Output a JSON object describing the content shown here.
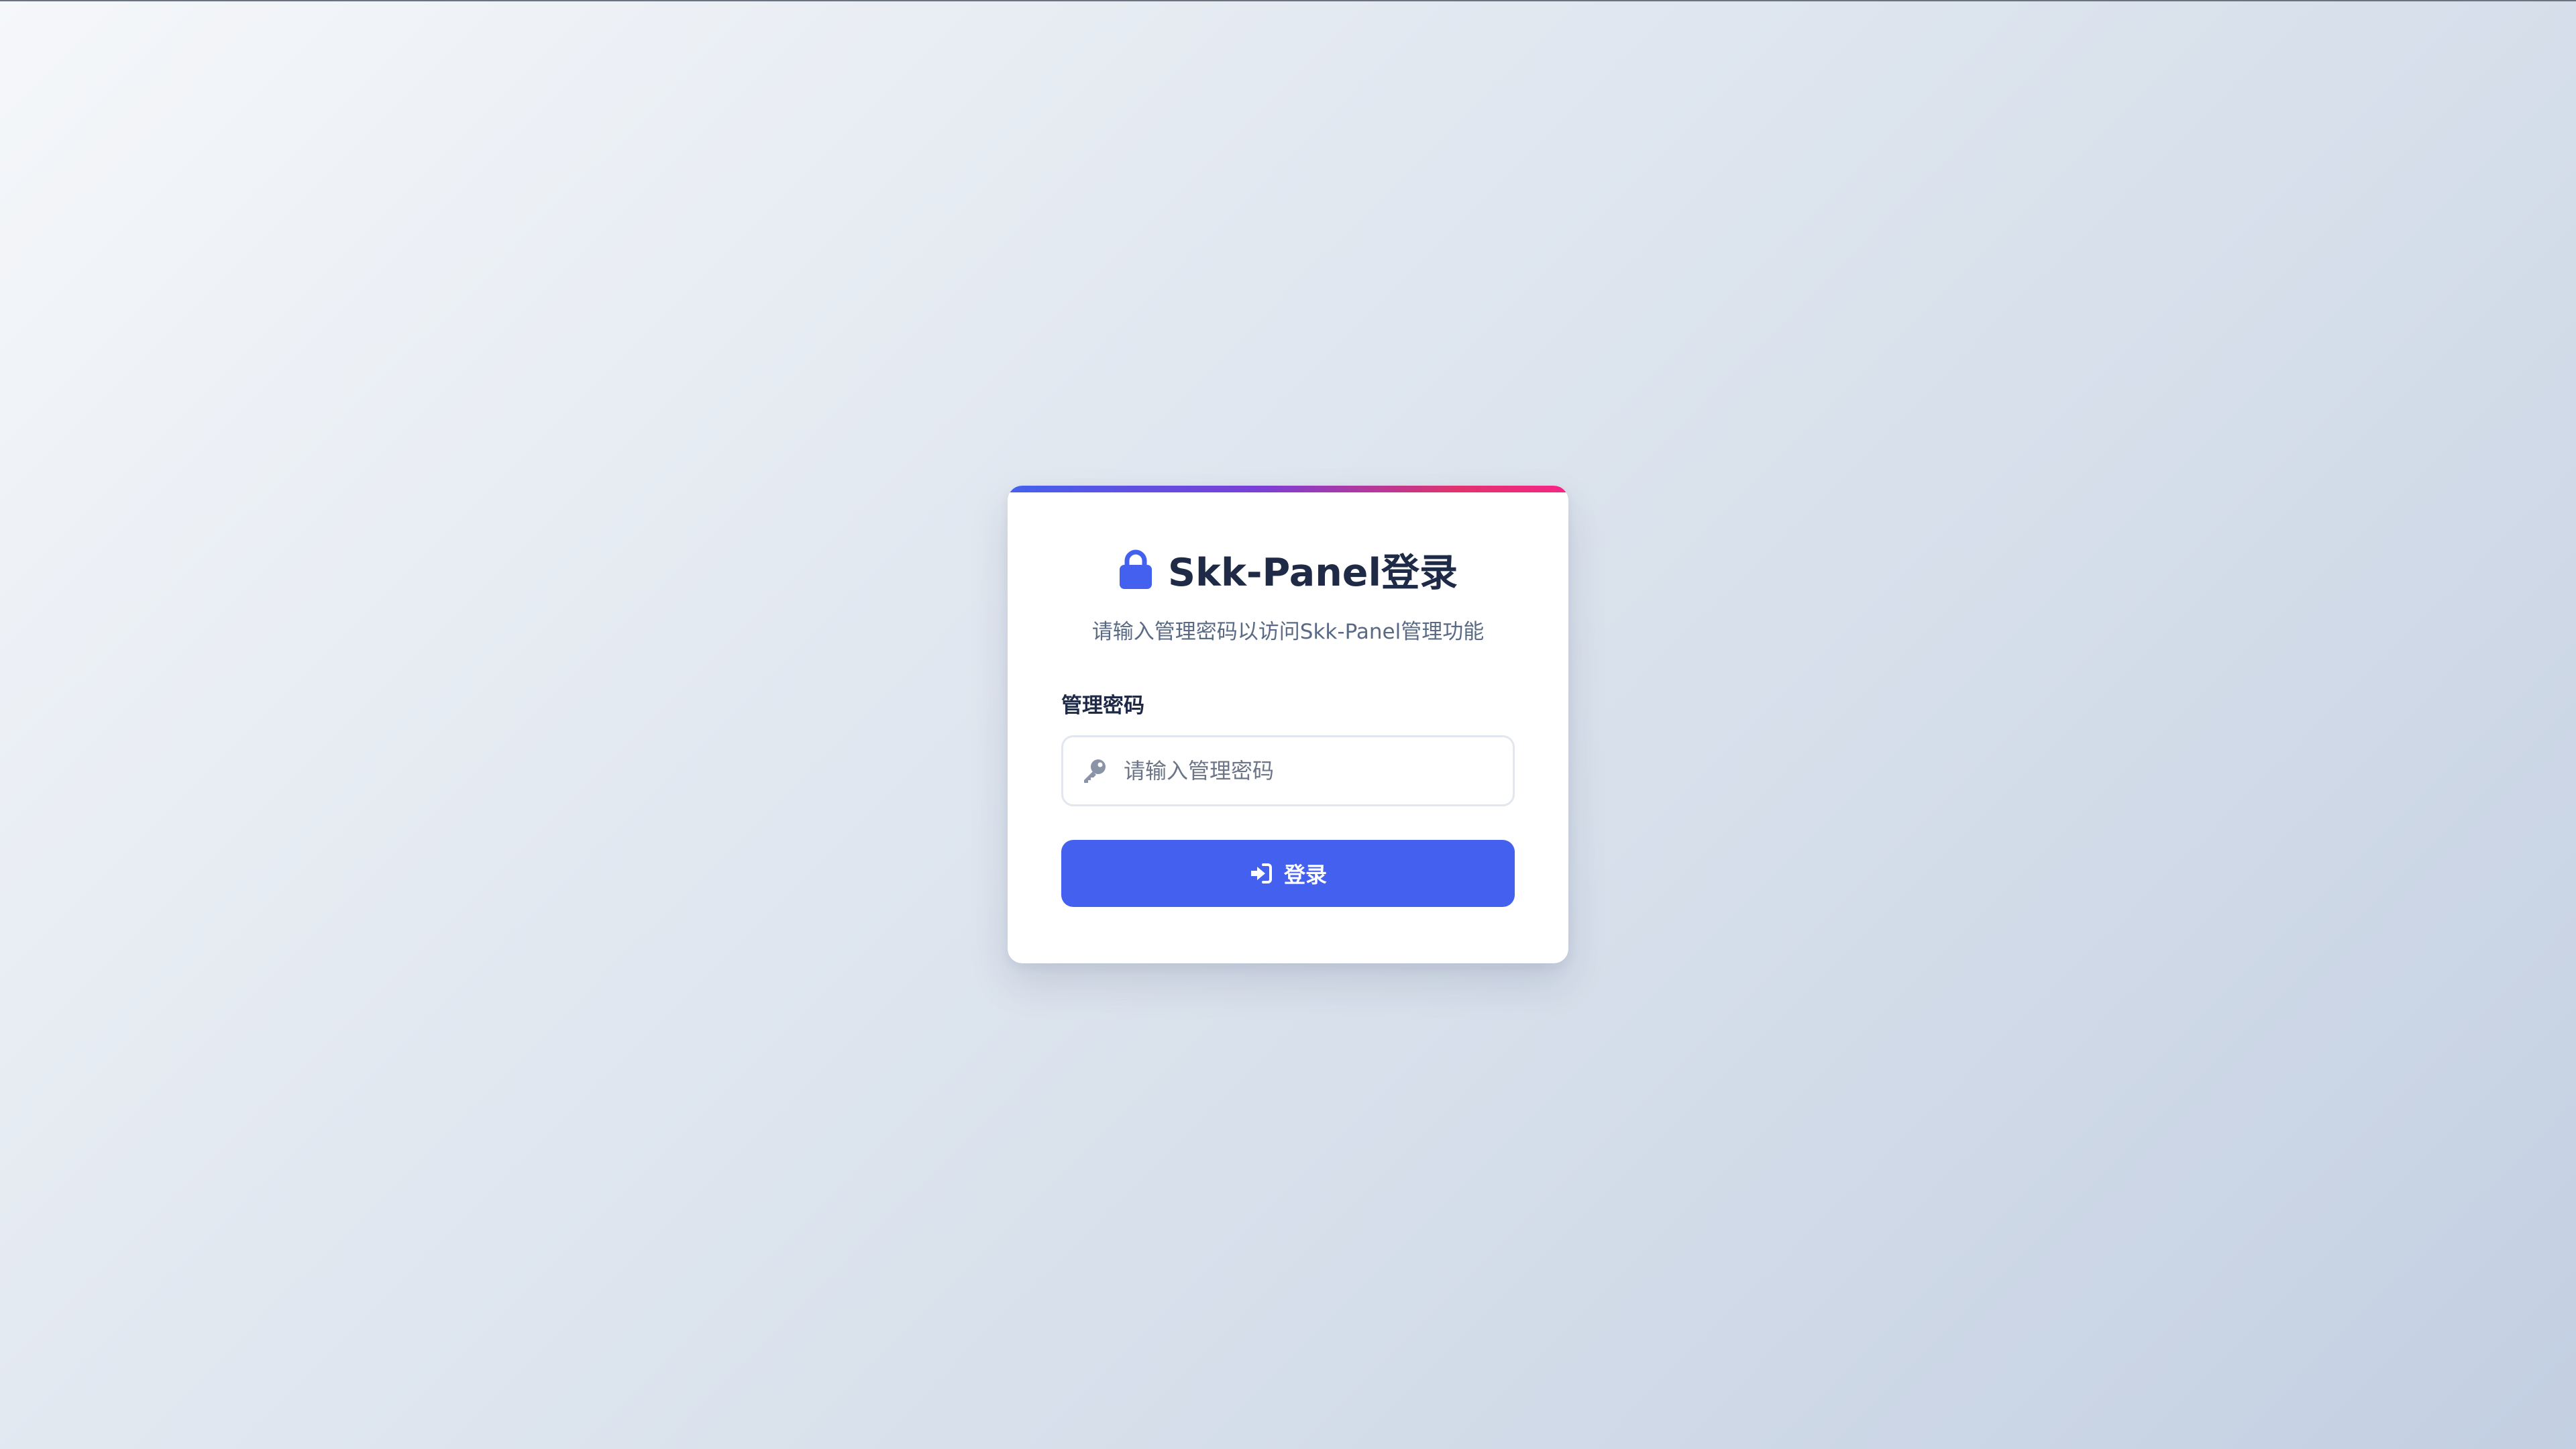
{
  "colors": {
    "accent": "#4361ee",
    "accent_gradient_end": "#f72585",
    "title_text": "#1e2a46",
    "subtitle_text": "#5a6a85",
    "input_border": "#e2e6ee",
    "icon_muted": "#8a94a6"
  },
  "login_card": {
    "title_icon": "lock-icon",
    "title": "Skk-Panel登录",
    "subtitle": "请输入管理密码以访问Skk-Panel管理功能",
    "password_field": {
      "label": "管理密码",
      "icon": "key-icon",
      "placeholder": "请输入管理密码",
      "value": ""
    },
    "login_button": {
      "icon": "sign-in-icon",
      "label": "登录"
    }
  }
}
